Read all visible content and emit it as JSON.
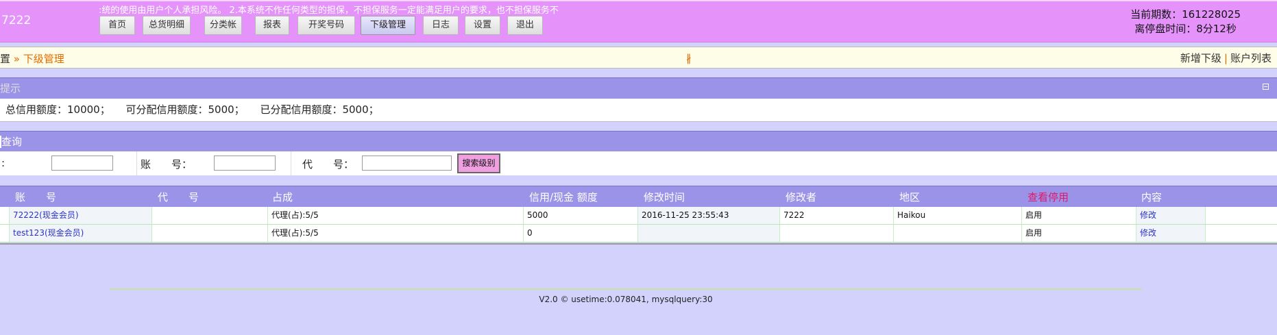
{
  "header": {
    "logo": "7222",
    "notice": ":统的使用由用户个人承担风险。 2.本系统不作任何类型的担保，不担保服务一定能满足用户的要求，也不担保服务不",
    "nav": [
      "首页",
      "总货明细",
      "分类帐",
      "报表",
      "开奖号码",
      "下级管理",
      "日志",
      "设置",
      "退出"
    ],
    "period_label": "当前期数：161228025",
    "countdown_label": "离停盘时间：8分12秒"
  },
  "breadcrumb": {
    "prefix": "置",
    "sep": "»",
    "current": "下级管理",
    "center_glyph": "∦"
  },
  "top_links": {
    "add": "新增下级",
    "sep": "|",
    "list": "账户列表"
  },
  "tips": {
    "title": "提示",
    "total_credit": "总信用额度：10000；",
    "available_credit": "可分配信用额度：5000；",
    "allocated_credit": "已分配信用额度：5000；"
  },
  "query": {
    "title": "查询",
    "label1": ":",
    "account_label": "账　　号：",
    "agent_label": "代　　号：",
    "search_button": "搜索级别",
    "field1_value": "",
    "account_value": "",
    "agent_value": ""
  },
  "table": {
    "headers": [
      "账　　号",
      "代　　号",
      "占成",
      "信用/现金 额度",
      "修改时间",
      "修改者",
      "地区",
      "查看停用",
      "内容"
    ],
    "rows": [
      {
        "account": "72222(现金会员)",
        "agent": "",
        "share": "代理(占):5/5",
        "credit": "5000",
        "modified": "2016-11-25 23:55:43",
        "modifier": "7222",
        "region": "Haikou",
        "status": "启用",
        "action": "修改"
      },
      {
        "account": "test123(现金会员)",
        "agent": "",
        "share": "代理(占):5/5",
        "credit": "0",
        "modified": "",
        "modifier": "",
        "region": "",
        "status": "启用",
        "action": "修改"
      }
    ]
  },
  "footer": {
    "text": "V2.0 © usetime:0.078041, mysqlquery:30"
  }
}
